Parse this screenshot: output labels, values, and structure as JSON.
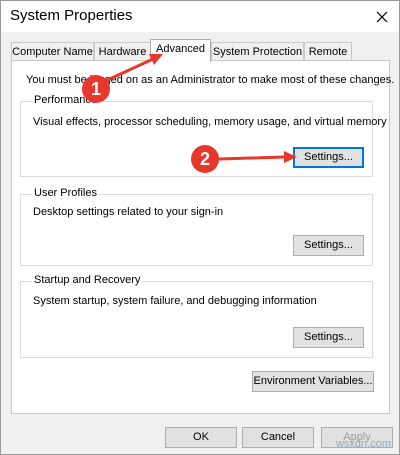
{
  "window": {
    "title": "System Properties"
  },
  "tabs": [
    "Computer Name",
    "Hardware",
    "Advanced",
    "System Protection",
    "Remote"
  ],
  "intro_text": "You must be logged on as an Administrator to make most of these changes.",
  "performance": {
    "title": "Performance",
    "description": "Visual effects, processor scheduling, memory usage, and virtual memory",
    "button": "Settings..."
  },
  "user_profiles": {
    "title": "User Profiles",
    "description": "Desktop settings related to your sign-in",
    "button": "Settings..."
  },
  "startup_recovery": {
    "title": "Startup and Recovery",
    "description": "System startup, system failure, and debugging information",
    "button": "Settings..."
  },
  "env_button": "Environment Variables...",
  "footer": {
    "ok": "OK",
    "cancel": "Cancel",
    "apply": "Apply"
  },
  "annotations": {
    "marker1": "1",
    "marker2": "2",
    "color": "#e8372d"
  },
  "watermark": "wsxdn.com"
}
